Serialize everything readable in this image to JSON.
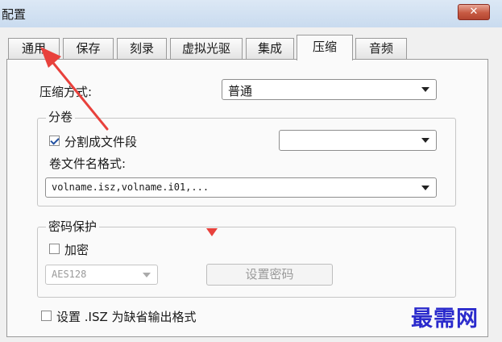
{
  "window": {
    "title": "配置",
    "close_glyph": "✕"
  },
  "tabs": [
    {
      "label": "通用",
      "active": false
    },
    {
      "label": "保存",
      "active": false
    },
    {
      "label": "刻录",
      "active": false
    },
    {
      "label": "虚拟光驱",
      "active": false
    },
    {
      "label": "集成",
      "active": false
    },
    {
      "label": "压缩",
      "active": true
    },
    {
      "label": "音频",
      "active": false
    }
  ],
  "compression": {
    "method_label": "压缩方式:",
    "method_value": "普通"
  },
  "split": {
    "group_title": "分卷",
    "split_checkbox_label": "分割成文件段",
    "split_checked": true,
    "split_size_value": "",
    "filename_format_label": "卷文件名格式:",
    "filename_format_value": "volname.isz,volname.i01,..."
  },
  "password": {
    "group_title": "密码保护",
    "encrypt_label": "加密",
    "encrypt_checked": false,
    "algorithm_value": "AES128",
    "set_password_label": "设置密码"
  },
  "default_format": {
    "label": "设置 .ISZ 为缺省输出格式",
    "checked": false
  },
  "watermark": {
    "text": "最需网"
  },
  "colors": {
    "annotation_red": "#e8413c",
    "watermark_blue": "#2a2acc",
    "titlebar": "#c9dbef",
    "close_button": "#c75a43"
  }
}
